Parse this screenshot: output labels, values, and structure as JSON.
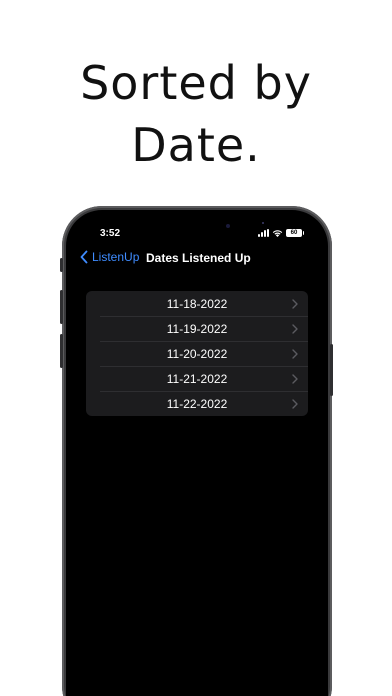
{
  "headline": {
    "line1": "Sorted by",
    "line2": "Date."
  },
  "status_bar": {
    "time": "3:52",
    "battery": "60"
  },
  "nav": {
    "back_label": "ListenUp",
    "title": "Dates Listened Up"
  },
  "dates": [
    {
      "label": "11-18-2022"
    },
    {
      "label": "11-19-2022"
    },
    {
      "label": "11-20-2022"
    },
    {
      "label": "11-21-2022"
    },
    {
      "label": "11-22-2022"
    }
  ],
  "colors": {
    "accent": "#3f8cff",
    "screen_background": "#000000",
    "list_background": "#1c1c1e"
  }
}
